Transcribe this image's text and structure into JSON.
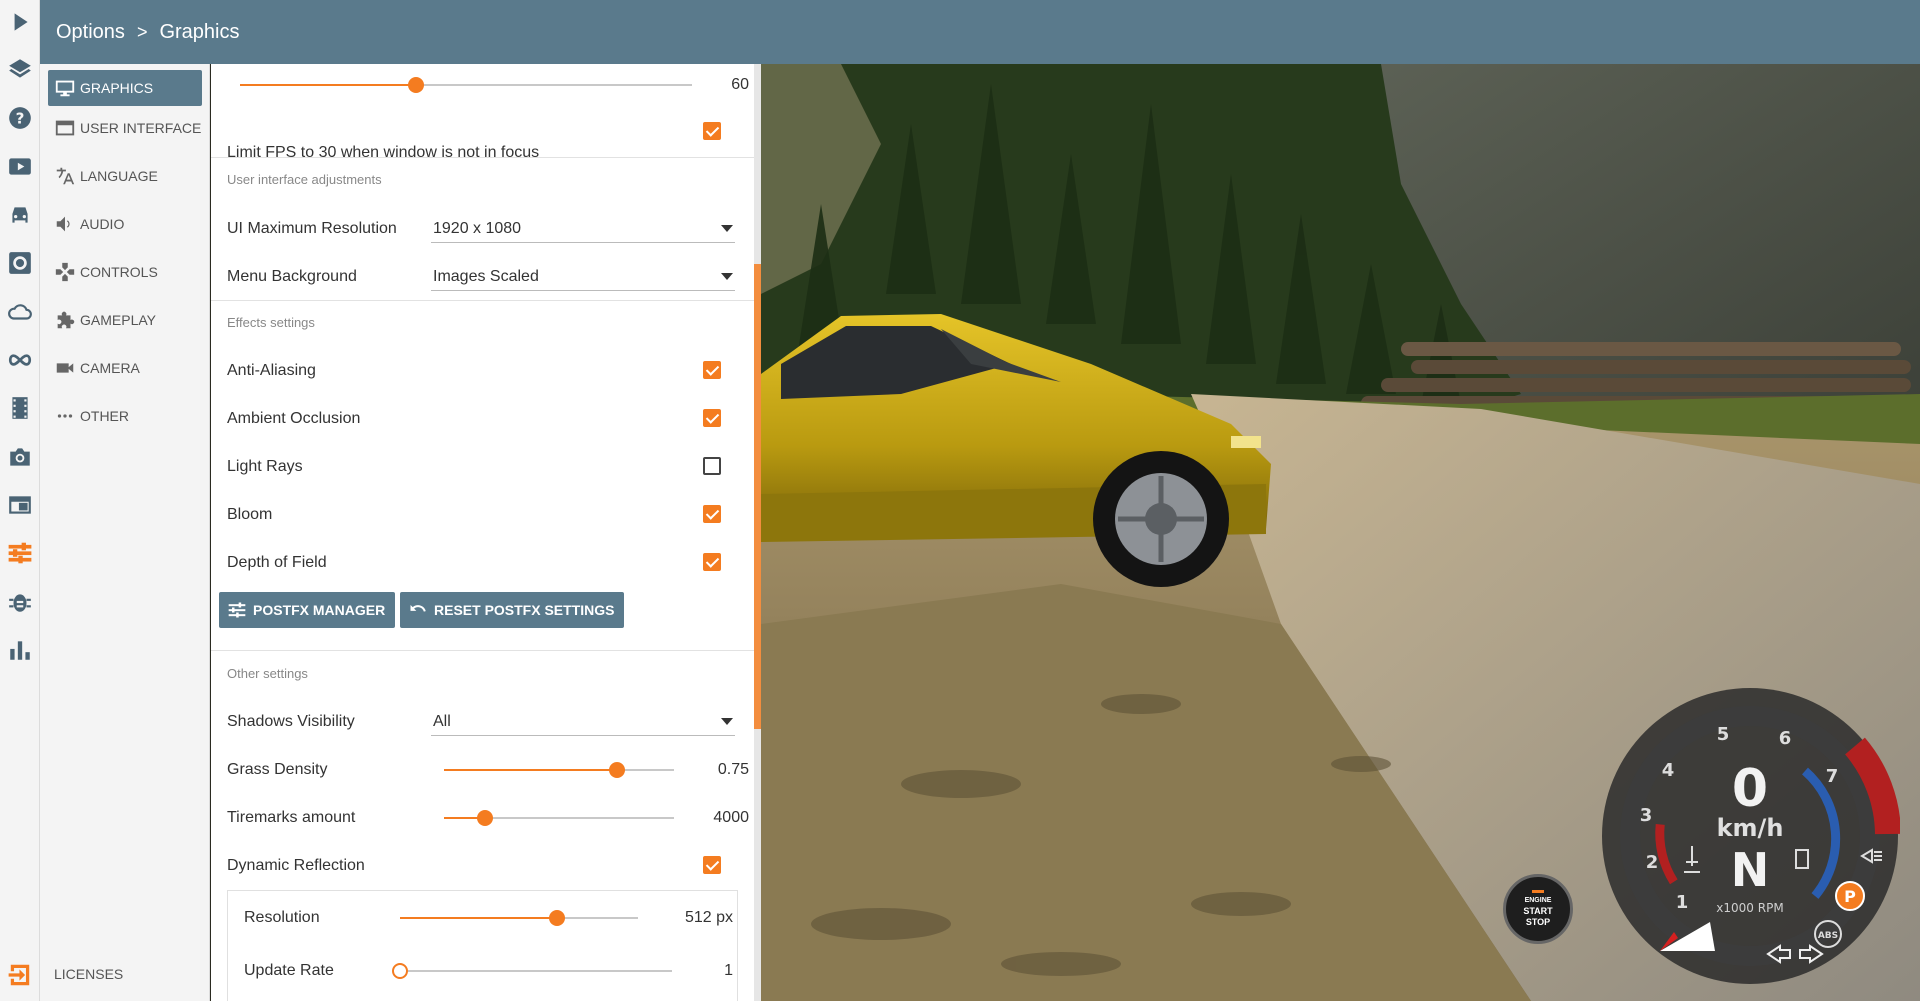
{
  "breadcrumb": {
    "root": "Options",
    "separator": ">",
    "current": "Graphics"
  },
  "rail_icons": [
    "play-icon",
    "layers-icon",
    "help-icon",
    "video-icon",
    "car-icon",
    "gear-box-icon",
    "cloud-icon",
    "infinity-icon",
    "film-icon",
    "camera-icon",
    "browser-icon",
    "sliders-icon",
    "bug-icon",
    "bar-chart-icon",
    "exit-icon"
  ],
  "nav": {
    "items": [
      {
        "label": "GRAPHICS",
        "icon": "monitor-icon",
        "active": true
      },
      {
        "label": "USER INTERFACE",
        "icon": "window-icon",
        "active": false
      },
      {
        "label": "LANGUAGE",
        "icon": "translate-icon",
        "active": false
      },
      {
        "label": "AUDIO",
        "icon": "speaker-icon",
        "active": false
      },
      {
        "label": "CONTROLS",
        "icon": "gamepad-icon",
        "active": false
      },
      {
        "label": "GAMEPLAY",
        "icon": "puzzle-icon",
        "active": false
      },
      {
        "label": "CAMERA",
        "icon": "videocam-icon",
        "active": false
      },
      {
        "label": "OTHER",
        "icon": "more-icon",
        "active": false
      }
    ],
    "licenses": "LICENSES"
  },
  "settings": {
    "top_slider": {
      "value_text": "60",
      "fraction": 0.39
    },
    "limit_fps": {
      "label": "Limit FPS to 30 when window is not in focus",
      "checked": true
    },
    "ui_section": "User interface adjustments",
    "ui_max_res": {
      "label": "UI Maximum Resolution",
      "value": "1920 x 1080"
    },
    "menu_bg": {
      "label": "Menu Background",
      "value": "Images Scaled"
    },
    "effects_section": "Effects settings",
    "effects": [
      {
        "label": "Anti-Aliasing",
        "checked": true
      },
      {
        "label": "Ambient Occlusion",
        "checked": true
      },
      {
        "label": "Light Rays",
        "checked": false
      },
      {
        "label": "Bloom",
        "checked": true
      },
      {
        "label": "Depth of Field",
        "checked": true
      }
    ],
    "postfx_manager": "POSTFX MANAGER",
    "reset_postfx": "RESET POSTFX SETTINGS",
    "other_section": "Other settings",
    "shadows": {
      "label": "Shadows Visibility",
      "value": "All"
    },
    "grass": {
      "label": "Grass Density",
      "value_text": "0.75",
      "fraction": 0.75
    },
    "tiremarks": {
      "label": "Tiremarks amount",
      "value_text": "4000",
      "fraction": 0.18
    },
    "dyn_reflection": {
      "label": "Dynamic Reflection",
      "checked": true
    },
    "resolution": {
      "label": "Resolution",
      "value_text": "512 px",
      "fraction": 0.66
    },
    "update_rate": {
      "label": "Update Rate",
      "value_text": "1",
      "fraction": 0.0
    }
  },
  "hud": {
    "speed": "0",
    "unit": "km/h",
    "gear": "N",
    "rpm_label": "x1000 RPM",
    "ticks": [
      "1",
      "2",
      "3",
      "4",
      "5",
      "6",
      "7"
    ],
    "park": "P",
    "abs": "ABS",
    "engine": {
      "line1": "ENGINE",
      "line2": "START",
      "line3": "STOP"
    }
  },
  "colors": {
    "accent": "#f47c20",
    "header": "#5a7a8c"
  }
}
